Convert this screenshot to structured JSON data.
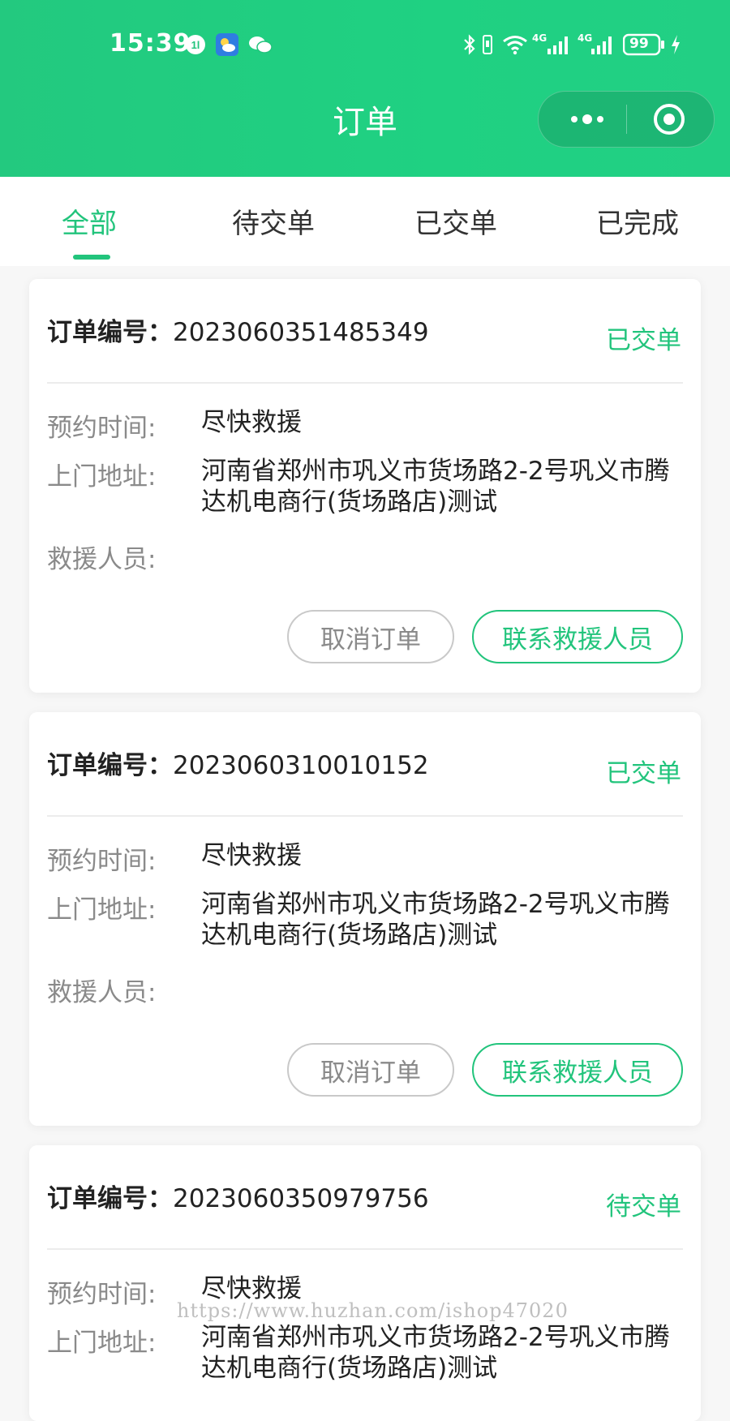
{
  "status_bar": {
    "time": "15:39",
    "battery": "99",
    "network_1": "4G",
    "network_2": "4G",
    "left_icons": [
      "notification-badge-icon",
      "weather-app-icon",
      "wechat-icon"
    ],
    "right_icons": [
      "bluetooth-icon",
      "vibrate-icon",
      "wifi-icon",
      "signal-icon",
      "signal-icon",
      "battery-icon",
      "charging-icon"
    ]
  },
  "nav": {
    "title": "订单",
    "capsule_icons": [
      "more-dots-icon",
      "close-miniprogram-icon"
    ]
  },
  "tabs": [
    {
      "label": "全部",
      "active": true
    },
    {
      "label": "待交单",
      "active": false
    },
    {
      "label": "已交单",
      "active": false
    },
    {
      "label": "已完成",
      "active": false
    }
  ],
  "labels": {
    "order_no": "订单编号：",
    "appointment": "预约时间:",
    "address": "上门地址:",
    "rescuer": "救援人员:",
    "cancel": "取消订单",
    "contact": "联系救援人员"
  },
  "orders": [
    {
      "order_no": "2023060351485349",
      "status": "已交单",
      "appointment": "尽快救援",
      "address": "河南省郑州市巩义市货场路2-2号巩义市腾达机电商行(货场路店)测试",
      "rescuer": ""
    },
    {
      "order_no": "2023060310010152",
      "status": "已交单",
      "appointment": "尽快救援",
      "address": "河南省郑州市巩义市货场路2-2号巩义市腾达机电商行(货场路店)测试",
      "rescuer": ""
    },
    {
      "order_no": "2023060350979756",
      "status": "待交单",
      "appointment": "尽快救援",
      "address": "河南省郑州市巩义市货场路2-2号巩义市腾达机电商行(货场路店)测试",
      "rescuer": ""
    }
  ],
  "watermark": "https://www.huzhan.com/ishop47020",
  "colors": {
    "accent": "#22c47c",
    "header_gradient_start": "#23c97f",
    "label_gray": "#8a8a8a",
    "page_bg": "#f7f7f7"
  }
}
